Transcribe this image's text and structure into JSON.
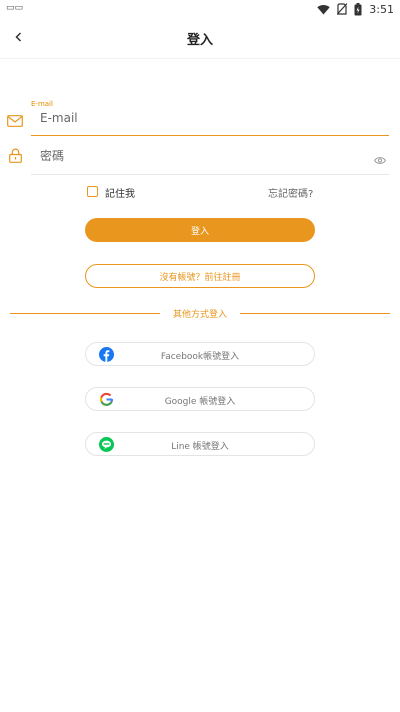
{
  "status_bar": {
    "time": "3:51",
    "notification": "▭▭"
  },
  "header": {
    "title": "登入"
  },
  "email": {
    "floating_label": "E-mail",
    "placeholder": "E-mail"
  },
  "password": {
    "placeholder": "密碼"
  },
  "remember": {
    "label": "記住我",
    "checked": false
  },
  "forgot": {
    "label": "忘記密碼?"
  },
  "login_button": {
    "label": "登入"
  },
  "register_button": {
    "label": "沒有帳號？前往註冊"
  },
  "other_methods": {
    "label": "其他方式登入"
  },
  "social": [
    {
      "label": "Facebook帳號登入",
      "icon": "facebook-icon"
    },
    {
      "label": "Google 帳號登入",
      "icon": "google-icon"
    },
    {
      "label": "Line 帳號登入",
      "icon": "line-icon"
    }
  ],
  "colors": {
    "accent": "#e8961e",
    "facebook": "#1877f2",
    "line": "#06c755"
  }
}
